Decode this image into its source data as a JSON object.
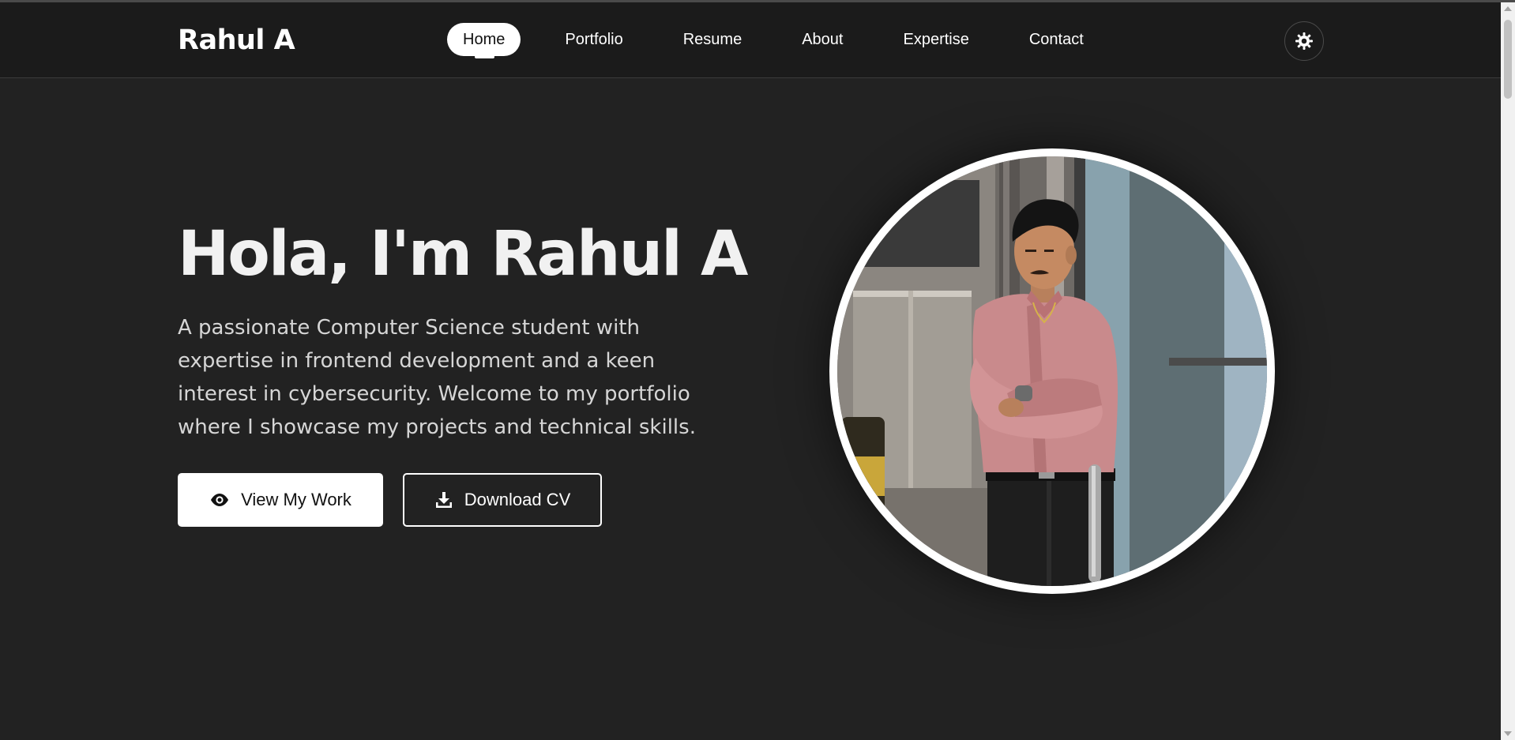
{
  "site": {
    "logo": "Rahul A"
  },
  "nav": {
    "items": [
      {
        "label": "Home",
        "active": true
      },
      {
        "label": "Portfolio",
        "active": false
      },
      {
        "label": "Resume",
        "active": false
      },
      {
        "label": "About",
        "active": false
      },
      {
        "label": "Expertise",
        "active": false
      },
      {
        "label": "Contact",
        "active": false
      }
    ],
    "theme_toggle_icon": "sun-gear-icon"
  },
  "hero": {
    "title": "Hola, I'm Rahul A",
    "description": "A passionate Computer Science student with expertise in frontend development and a keen interest in cybersecurity. Welcome to my portfolio where I showcase my projects and technical skills.",
    "primary_button": {
      "label": "View My Work",
      "icon": "eye-icon"
    },
    "secondary_button": {
      "label": "Download CV",
      "icon": "download-icon"
    },
    "portrait_alt": "profile-photo"
  },
  "colors": {
    "background": "#222222",
    "navbar": "#1b1b1b",
    "accent": "#ffffff",
    "text_muted": "#d6d6d6"
  }
}
